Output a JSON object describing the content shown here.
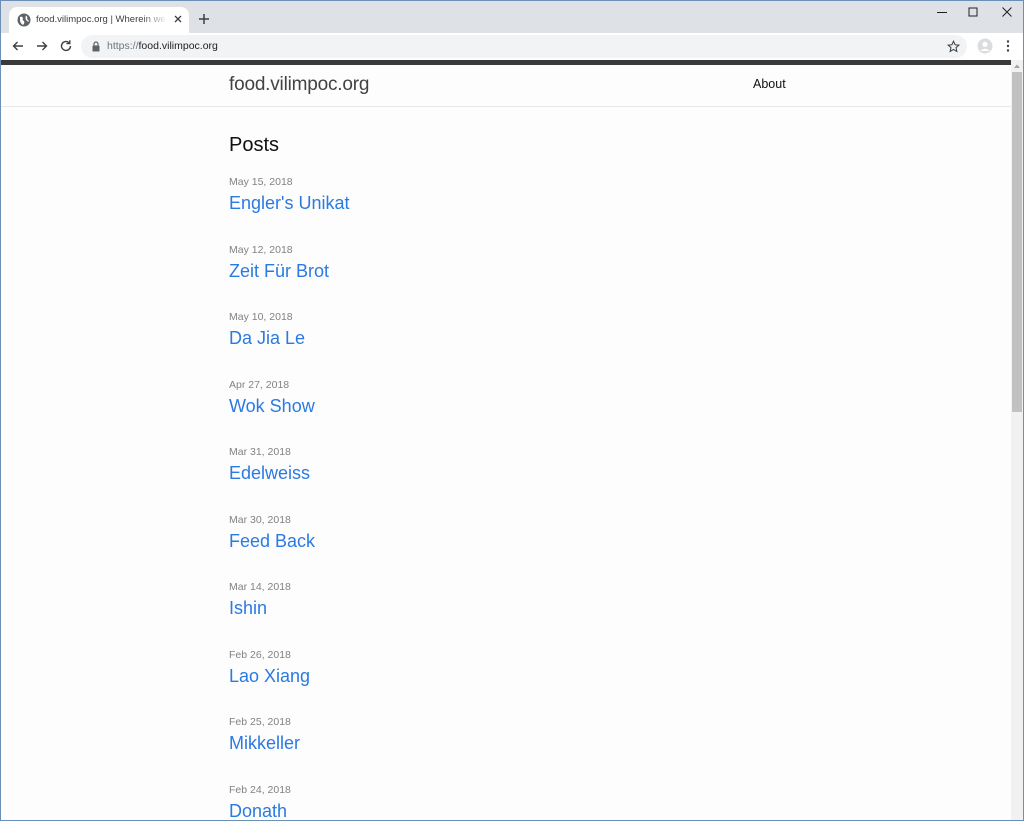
{
  "browser": {
    "tab_title": "food.vilimpoc.org | Wherein we",
    "url_scheme": "https://",
    "url_host": "food.vilimpoc.org"
  },
  "site": {
    "title": "food.vilimpoc.org",
    "nav_about": "About"
  },
  "posts": {
    "heading": "Posts",
    "items": [
      {
        "date": "May 15, 2018",
        "title": "Engler's Unikat"
      },
      {
        "date": "May 12, 2018",
        "title": "Zeit Für Brot"
      },
      {
        "date": "May 10, 2018",
        "title": "Da Jia Le"
      },
      {
        "date": "Apr 27, 2018",
        "title": "Wok Show"
      },
      {
        "date": "Mar 31, 2018",
        "title": "Edelweiss"
      },
      {
        "date": "Mar 30, 2018",
        "title": "Feed Back"
      },
      {
        "date": "Mar 14, 2018",
        "title": "Ishin"
      },
      {
        "date": "Feb 26, 2018",
        "title": "Lao Xiang"
      },
      {
        "date": "Feb 25, 2018",
        "title": "Mikkeller"
      },
      {
        "date": "Feb 24, 2018",
        "title": "Donath"
      }
    ]
  },
  "colors": {
    "link": "#2a7ae2",
    "date": "#828282",
    "tabstrip": "#dee1e6",
    "omnibox": "#f1f3f4"
  }
}
